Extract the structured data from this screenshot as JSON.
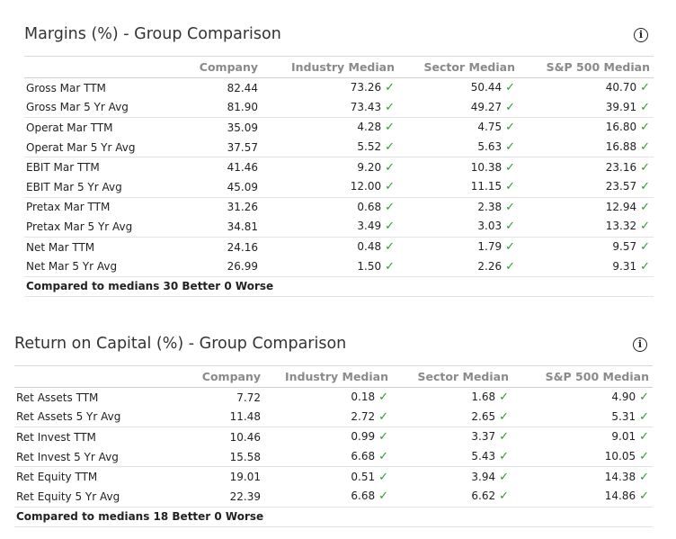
{
  "columns": [
    "Company",
    "Industry Median",
    "Sector Median",
    "S&P 500 Median"
  ],
  "check_glyph": "✓",
  "check_color": "#2f9a2f",
  "margins": {
    "title": "Margins (%) - Group Comparison",
    "rows": [
      {
        "label": "Gross Mar TTM",
        "company": "82.44",
        "industry": "73.26",
        "sector": "50.44",
        "sp500": "40.70"
      },
      {
        "label": "Gross Mar 5 Yr Avg",
        "company": "81.90",
        "industry": "73.43",
        "sector": "49.27",
        "sp500": "39.91"
      },
      {
        "label": "Operat Mar TTM",
        "company": "35.09",
        "industry": "4.28",
        "sector": "4.75",
        "sp500": "16.80"
      },
      {
        "label": "Operat Mar 5 Yr Avg",
        "company": "37.57",
        "industry": "5.52",
        "sector": "5.63",
        "sp500": "16.88"
      },
      {
        "label": "EBIT Mar TTM",
        "company": "41.46",
        "industry": "9.20",
        "sector": "10.38",
        "sp500": "23.16"
      },
      {
        "label": "EBIT Mar 5 Yr Avg",
        "company": "45.09",
        "industry": "12.00",
        "sector": "11.15",
        "sp500": "23.57"
      },
      {
        "label": "Pretax Mar TTM",
        "company": "31.26",
        "industry": "0.68",
        "sector": "2.38",
        "sp500": "12.94"
      },
      {
        "label": "Pretax Mar 5 Yr Avg",
        "company": "34.81",
        "industry": "3.49",
        "sector": "3.03",
        "sp500": "13.32"
      },
      {
        "label": "Net Mar TTM",
        "company": "24.16",
        "industry": "0.48",
        "sector": "1.79",
        "sp500": "9.57"
      },
      {
        "label": "Net Mar 5 Yr Avg",
        "company": "26.99",
        "industry": "1.50",
        "sector": "2.26",
        "sp500": "9.31"
      }
    ],
    "summary": "Compared to medians 30 Better 0 Worse"
  },
  "return_on_capital": {
    "title": "Return on Capital (%) - Group Comparison",
    "rows": [
      {
        "label": "Ret Assets TTM",
        "company": "7.72",
        "industry": "0.18",
        "sector": "1.68",
        "sp500": "4.90"
      },
      {
        "label": "Ret Assets 5 Yr Avg",
        "company": "11.48",
        "industry": "2.72",
        "sector": "2.65",
        "sp500": "5.31"
      },
      {
        "label": "Ret Invest TTM",
        "company": "10.46",
        "industry": "0.99",
        "sector": "3.37",
        "sp500": "9.01"
      },
      {
        "label": "Ret Invest 5 Yr Avg",
        "company": "15.58",
        "industry": "6.68",
        "sector": "5.43",
        "sp500": "10.05"
      },
      {
        "label": "Ret Equity TTM",
        "company": "19.01",
        "industry": "0.51",
        "sector": "3.94",
        "sp500": "14.38"
      },
      {
        "label": "Ret Equity 5 Yr Avg",
        "company": "22.39",
        "industry": "6.68",
        "sector": "6.62",
        "sp500": "14.86"
      }
    ],
    "summary": "Compared to medians 18 Better 0 Worse"
  }
}
